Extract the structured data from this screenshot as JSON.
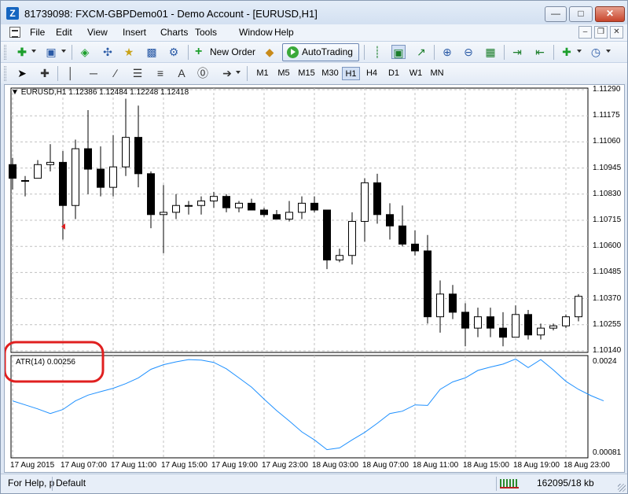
{
  "window": {
    "title": "81739098: FXCM-GBPDemo01 - Demo Account - [EURUSD,H1]",
    "app_icon_letter": "Z"
  },
  "menu": {
    "items": [
      "File",
      "Edit",
      "View",
      "Insert",
      "Charts",
      "Tools",
      "Window",
      "Help"
    ]
  },
  "toolbar": {
    "new_order_label": "New Order",
    "autotrading_label": "AutoTrading",
    "timeframes": [
      "M1",
      "M5",
      "M15",
      "M30",
      "H1",
      "H4",
      "D1",
      "W1",
      "MN"
    ],
    "active_timeframe": "H1"
  },
  "chart": {
    "header": "EURUSD,H1  1.12386 1.12484 1.12248 1.12418",
    "indicator_label": "ATR(14) 0.00256",
    "price_ticks": [
      "1.11290",
      "1.11175",
      "1.11060",
      "1.10945",
      "1.10830",
      "1.10715",
      "1.10600",
      "1.10485",
      "1.10370",
      "1.10255",
      "1.10140"
    ],
    "indicator_ticks": [
      "0.0024",
      "0.00081"
    ],
    "time_ticks": [
      "17 Aug 2015",
      "17 Aug 07:00",
      "17 Aug 11:00",
      "17 Aug 15:00",
      "17 Aug 19:00",
      "17 Aug 23:00",
      "18 Aug 03:00",
      "18 Aug 07:00",
      "18 Aug 11:00",
      "18 Aug 15:00",
      "18 Aug 19:00",
      "18 Aug 23:00"
    ],
    "colors": {
      "grid": "#c0c0c0",
      "candle": "#000000",
      "atr_line": "#1e90ff",
      "annotation": "#e02020"
    }
  },
  "chart_data": {
    "type": "candlestick",
    "symbol": "EURUSD",
    "timeframe": "H1",
    "ylim": [
      1.1014,
      1.1129
    ],
    "candles": [
      {
        "o": 1.1096,
        "h": 1.1099,
        "l": 1.1085,
        "c": 1.109
      },
      {
        "o": 1.1089,
        "h": 1.1091,
        "l": 1.1082,
        "c": 1.1089
      },
      {
        "o": 1.109,
        "h": 1.1098,
        "l": 1.109,
        "c": 1.1096
      },
      {
        "o": 1.1096,
        "h": 1.1105,
        "l": 1.1093,
        "c": 1.1097
      },
      {
        "o": 1.1097,
        "h": 1.1102,
        "l": 1.1063,
        "c": 1.1078
      },
      {
        "o": 1.1078,
        "h": 1.1107,
        "l": 1.1072,
        "c": 1.1103
      },
      {
        "o": 1.1103,
        "h": 1.112,
        "l": 1.1083,
        "c": 1.1094
      },
      {
        "o": 1.1094,
        "h": 1.1104,
        "l": 1.1082,
        "c": 1.1086
      },
      {
        "o": 1.1086,
        "h": 1.1109,
        "l": 1.1082,
        "c": 1.1095
      },
      {
        "o": 1.1095,
        "h": 1.1125,
        "l": 1.1091,
        "c": 1.1108
      },
      {
        "o": 1.1108,
        "h": 1.1122,
        "l": 1.1086,
        "c": 1.1092
      },
      {
        "o": 1.1092,
        "h": 1.1093,
        "l": 1.1068,
        "c": 1.1074
      },
      {
        "o": 1.1074,
        "h": 1.1087,
        "l": 1.1057,
        "c": 1.1075
      },
      {
        "o": 1.1075,
        "h": 1.1083,
        "l": 1.1072,
        "c": 1.1078
      },
      {
        "o": 1.1078,
        "h": 1.108,
        "l": 1.1074,
        "c": 1.1078
      },
      {
        "o": 1.1078,
        "h": 1.1082,
        "l": 1.1074,
        "c": 1.108
      },
      {
        "o": 1.108,
        "h": 1.1084,
        "l": 1.1077,
        "c": 1.1082
      },
      {
        "o": 1.1082,
        "h": 1.1083,
        "l": 1.1075,
        "c": 1.1077
      },
      {
        "o": 1.1077,
        "h": 1.108,
        "l": 1.1075,
        "c": 1.1079
      },
      {
        "o": 1.1079,
        "h": 1.1081,
        "l": 1.1076,
        "c": 1.1076
      },
      {
        "o": 1.1076,
        "h": 1.1077,
        "l": 1.1073,
        "c": 1.1074
      },
      {
        "o": 1.1074,
        "h": 1.1076,
        "l": 1.1072,
        "c": 1.1072
      },
      {
        "o": 1.1072,
        "h": 1.108,
        "l": 1.1071,
        "c": 1.1075
      },
      {
        "o": 1.1075,
        "h": 1.1082,
        "l": 1.1072,
        "c": 1.1079
      },
      {
        "o": 1.1079,
        "h": 1.1082,
        "l": 1.1075,
        "c": 1.1076
      },
      {
        "o": 1.1076,
        "h": 1.1076,
        "l": 1.105,
        "c": 1.1054
      },
      {
        "o": 1.1054,
        "h": 1.1059,
        "l": 1.1053,
        "c": 1.1056
      },
      {
        "o": 1.1056,
        "h": 1.1075,
        "l": 1.1052,
        "c": 1.1071
      },
      {
        "o": 1.1071,
        "h": 1.109,
        "l": 1.1062,
        "c": 1.1088
      },
      {
        "o": 1.1088,
        "h": 1.1092,
        "l": 1.107,
        "c": 1.1074
      },
      {
        "o": 1.1074,
        "h": 1.1079,
        "l": 1.1063,
        "c": 1.1069
      },
      {
        "o": 1.1069,
        "h": 1.1078,
        "l": 1.106,
        "c": 1.1061
      },
      {
        "o": 1.1061,
        "h": 1.1067,
        "l": 1.1056,
        "c": 1.1058
      },
      {
        "o": 1.1058,
        "h": 1.1065,
        "l": 1.1026,
        "c": 1.1029
      },
      {
        "o": 1.1029,
        "h": 1.1045,
        "l": 1.1022,
        "c": 1.1039
      },
      {
        "o": 1.1039,
        "h": 1.1043,
        "l": 1.1028,
        "c": 1.1031
      },
      {
        "o": 1.1031,
        "h": 1.1035,
        "l": 1.1016,
        "c": 1.1024
      },
      {
        "o": 1.1024,
        "h": 1.1033,
        "l": 1.102,
        "c": 1.1029
      },
      {
        "o": 1.1029,
        "h": 1.1033,
        "l": 1.102,
        "c": 1.1024
      },
      {
        "o": 1.1024,
        "h": 1.1031,
        "l": 1.1016,
        "c": 1.102
      },
      {
        "o": 1.102,
        "h": 1.1034,
        "l": 1.102,
        "c": 1.103
      },
      {
        "o": 1.103,
        "h": 1.1032,
        "l": 1.1019,
        "c": 1.1021
      },
      {
        "o": 1.1021,
        "h": 1.1026,
        "l": 1.1019,
        "c": 1.1024
      },
      {
        "o": 1.1024,
        "h": 1.1026,
        "l": 1.1023,
        "c": 1.1025
      },
      {
        "o": 1.1025,
        "h": 1.103,
        "l": 1.1024,
        "c": 1.1029
      },
      {
        "o": 1.1029,
        "h": 1.1039,
        "l": 1.1027,
        "c": 1.1038
      }
    ],
    "atr": {
      "name": "ATR(14)",
      "ylim": [
        0.00081,
        0.0024
      ],
      "values": [
        0.00172,
        0.00165,
        0.00158,
        0.0015,
        0.00157,
        0.00172,
        0.00182,
        0.00188,
        0.00194,
        0.00202,
        0.00212,
        0.00227,
        0.00235,
        0.0024,
        0.00244,
        0.00243,
        0.00239,
        0.00228,
        0.00212,
        0.00196,
        0.00175,
        0.00155,
        0.00137,
        0.00118,
        0.00104,
        0.00087,
        0.0009,
        0.00104,
        0.00117,
        0.00133,
        0.0015,
        0.00154,
        0.00165,
        0.00164,
        0.00192,
        0.00205,
        0.00212,
        0.00225,
        0.00231,
        0.00236,
        0.00245,
        0.0023,
        0.00244,
        0.00226,
        0.00206,
        0.00192,
        0.00181,
        0.00172
      ]
    }
  },
  "status": {
    "help_text": "For Help, p",
    "profile": "Default",
    "traffic": "162095/18 kb"
  }
}
